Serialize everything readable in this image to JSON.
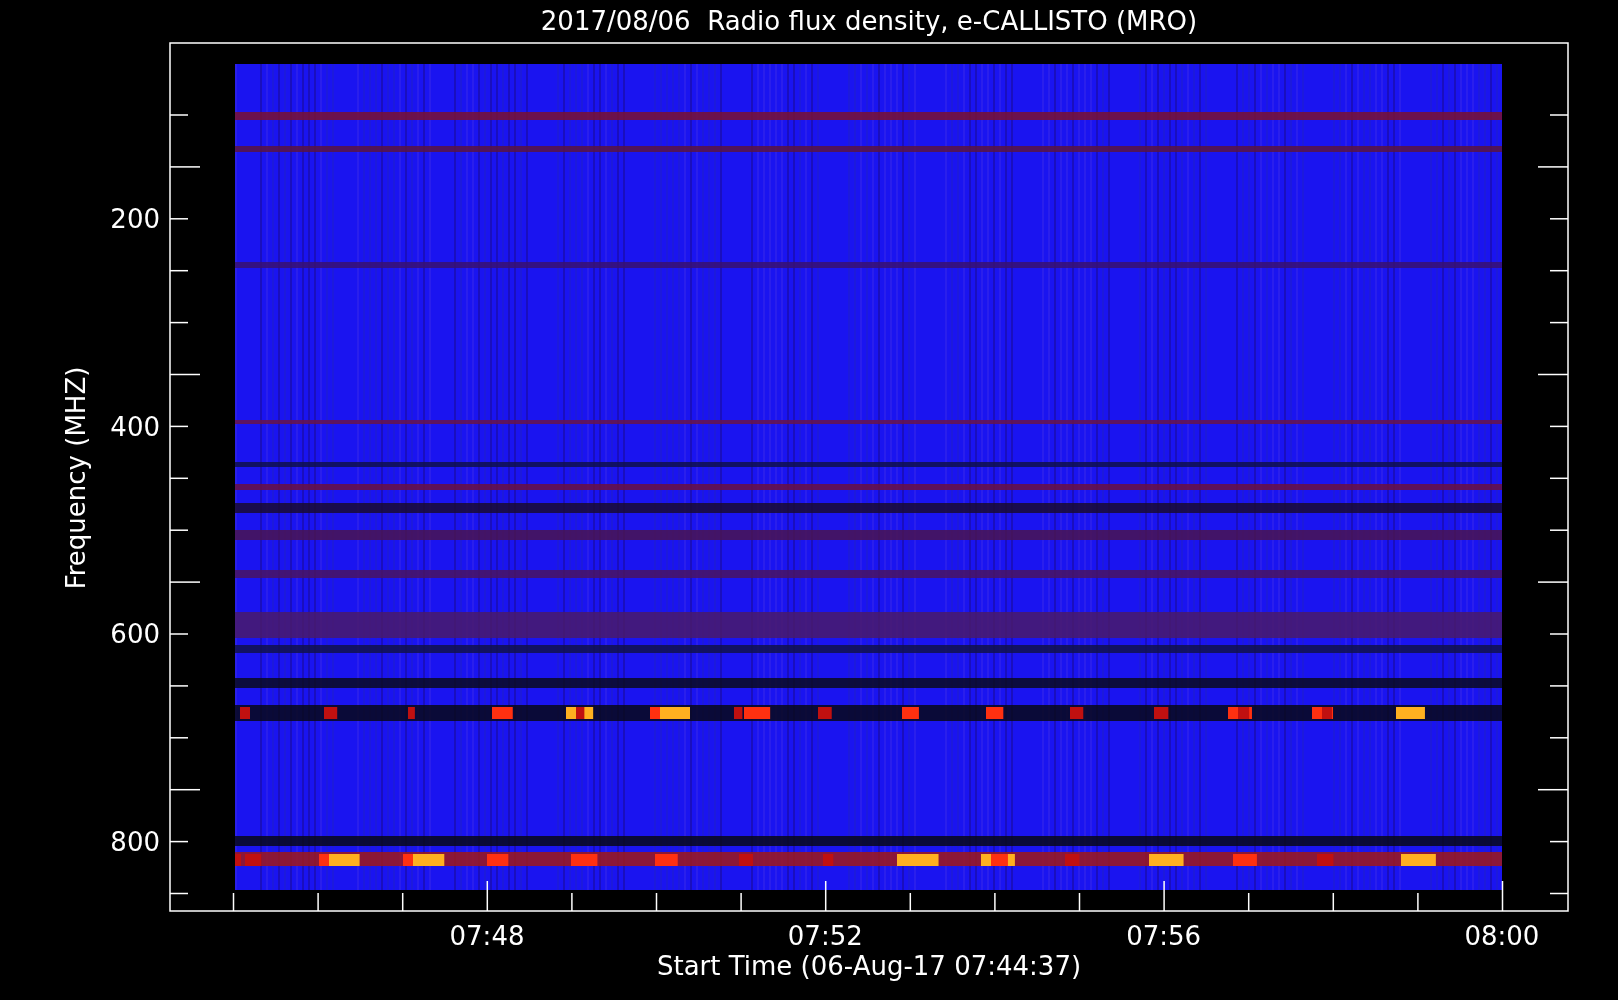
{
  "plot": {
    "title": "2017/08/06  Radio flux density, e-CALLISTO (MRO)",
    "ylabel": "Frequency (MHZ)",
    "xlabel": "Start Time (06-Aug-17 07:44:37)",
    "y_tick_labels": [
      "200",
      "400",
      "600",
      "800"
    ],
    "x_tick_labels": [
      "07:48",
      "07:52",
      "07:56",
      "08:00"
    ]
  }
}
